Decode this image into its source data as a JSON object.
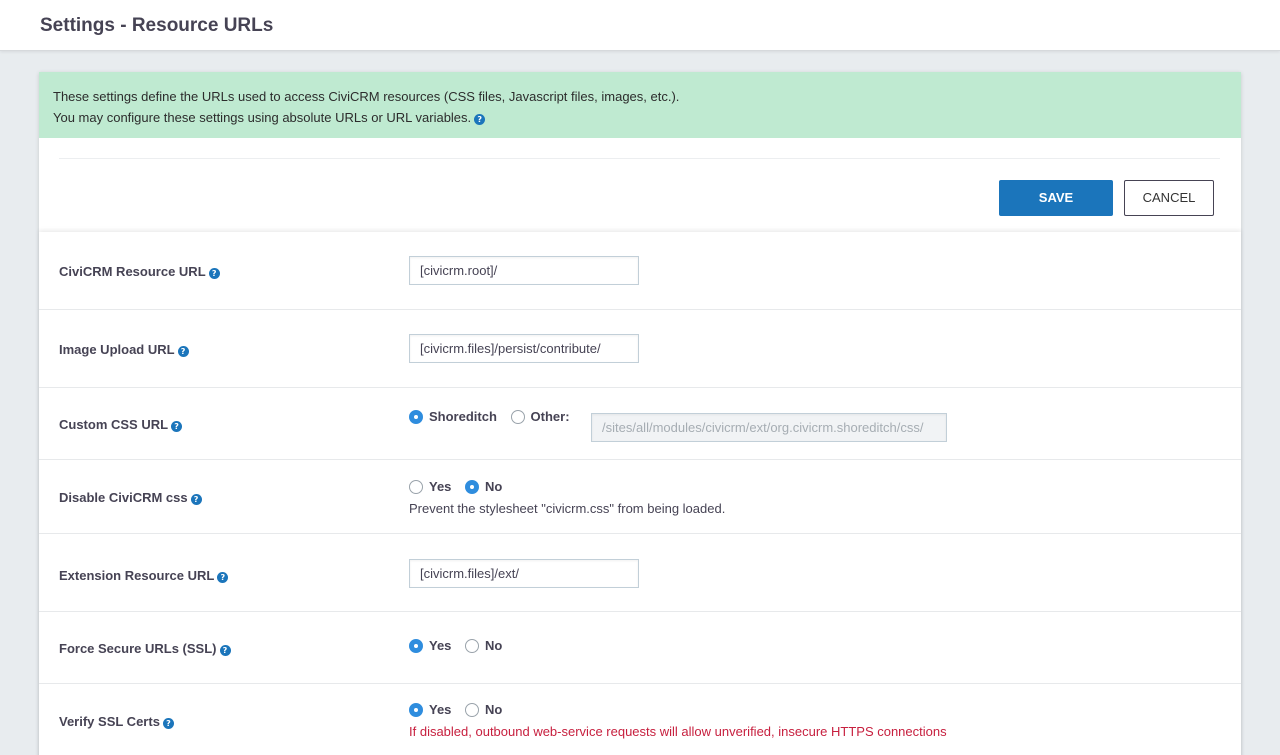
{
  "page": {
    "title": "Settings - Resource URLs"
  },
  "notice": {
    "line1": "These settings define the URLs used to access CiviCRM resources (CSS files, Javascript files, images, etc.).",
    "line2": "You may configure these settings using absolute URLs or URL variables."
  },
  "actions": {
    "save_label": "SAVE",
    "cancel_label": "CANCEL"
  },
  "fields": {
    "resource_url": {
      "label": "CiviCRM Resource URL",
      "value": "[civicrm.root]/"
    },
    "image_upload_url": {
      "label": "Image Upload URL",
      "value": "[civicrm.files]/persist/contribute/"
    },
    "custom_css_url": {
      "label": "Custom CSS URL",
      "option_shoreditch": "Shoreditch",
      "option_other": "Other:",
      "selected": "Shoreditch",
      "other_value": "/sites/all/modules/civicrm/ext/org.civicrm.shoreditch/css/"
    },
    "disable_css": {
      "label": "Disable CiviCRM css",
      "option_yes": "Yes",
      "option_no": "No",
      "selected": "No",
      "description": "Prevent the stylesheet \"civicrm.css\" from being loaded."
    },
    "extension_resource_url": {
      "label": "Extension Resource URL",
      "value": "[civicrm.files]/ext/"
    },
    "force_ssl": {
      "label": "Force Secure URLs (SSL)",
      "option_yes": "Yes",
      "option_no": "No",
      "selected": "Yes"
    },
    "verify_ssl": {
      "label": "Verify SSL Certs",
      "option_yes": "Yes",
      "option_no": "No",
      "selected": "Yes",
      "description": "If disabled, outbound web-service requests will allow unverified, insecure HTTPS connections"
    }
  },
  "colors": {
    "primary": "#1b75bb",
    "notice_bg": "#bfead1",
    "warning": "#c7203f",
    "radio_checked": "#2f8dde"
  },
  "icons": {
    "help": "question-circle-icon",
    "help_glyph": "?"
  }
}
